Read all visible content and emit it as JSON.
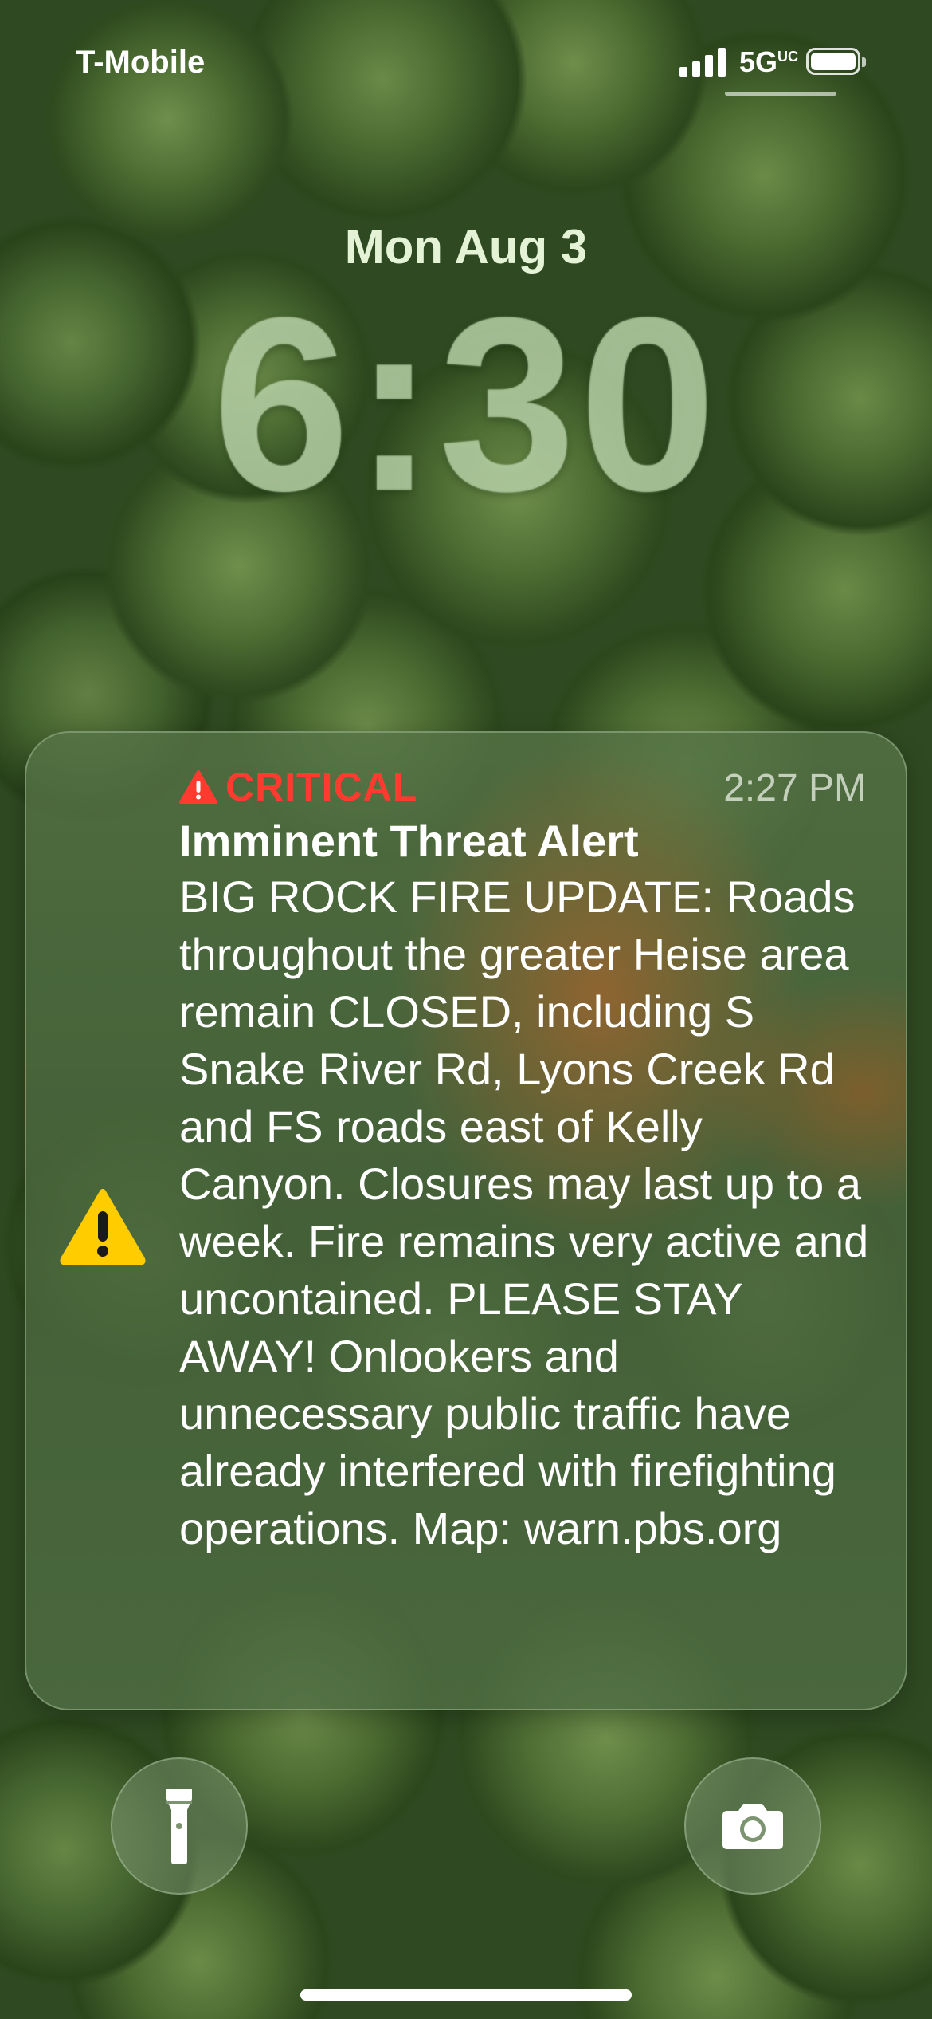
{
  "status_bar": {
    "carrier": "T-Mobile",
    "network": "5G",
    "network_superscript": "UC",
    "signal_icon": "cellular-signal-icon",
    "battery_icon": "battery-icon"
  },
  "lock_screen": {
    "date": "Mon Aug 3",
    "time": "6:30"
  },
  "alert": {
    "severity_icon": "warning-triangle-icon",
    "severity_label": "CRITICAL",
    "severity_color": "#ff3b30",
    "time": "2:27 PM",
    "title": "Imminent Threat Alert",
    "body": "BIG ROCK FIRE UPDATE: Roads throughout the greater Heise area remain CLOSED, including S Snake River Rd, Lyons Creek Rd and FS roads east of Kelly Canyon. Closures may last up to a week. Fire remains very active and uncontained. PLEASE STAY AWAY! Onlookers and unnecessary public traffic have already interfered with firefighting operations. Map: warn.pbs.org",
    "app_icon": "warning-sign-icon",
    "app_icon_color": "#ffcc00"
  },
  "quick_actions": {
    "left_icon": "flashlight-icon",
    "right_icon": "camera-icon"
  }
}
